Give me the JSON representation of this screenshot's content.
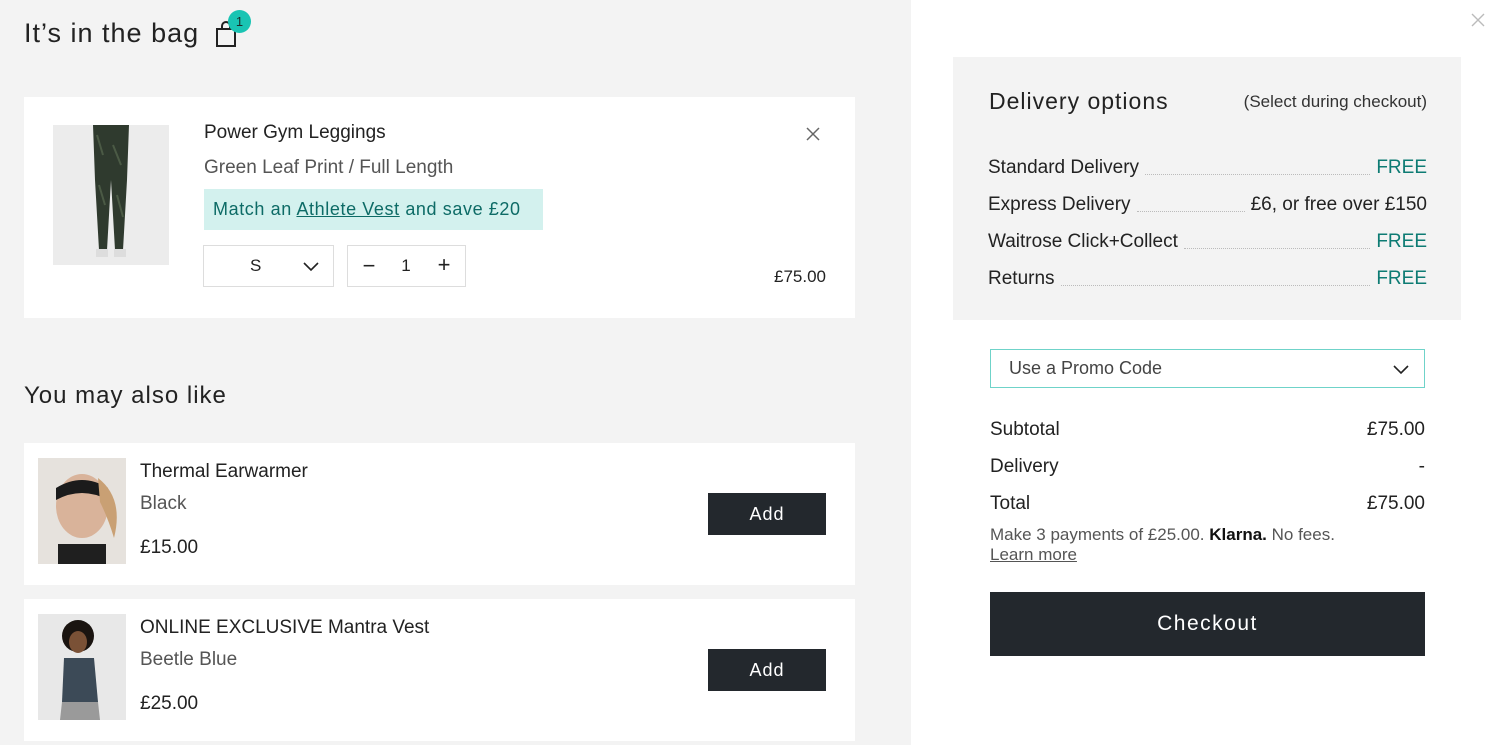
{
  "bag": {
    "title": "It’s in the bag",
    "count": "1",
    "item": {
      "name": "Power Gym Leggings",
      "variant": "Green Leaf Print / Full Length",
      "promo_prefix": "Match an ",
      "promo_link": "Athlete Vest",
      "promo_suffix": " and save £20",
      "size": "S",
      "quantity": "1",
      "price": "£75.00"
    }
  },
  "recommendations": {
    "title": "You may also like",
    "items": [
      {
        "name": "Thermal Earwarmer",
        "color": "Black",
        "price": "£15.00",
        "button": "Add"
      },
      {
        "name": "ONLINE EXCLUSIVE Mantra Vest",
        "color": "Beetle Blue",
        "price": "£25.00",
        "button": "Add"
      }
    ]
  },
  "delivery": {
    "title": "Delivery options",
    "note": "(Select during checkout)",
    "options": [
      {
        "label": "Standard Delivery",
        "value": "FREE"
      },
      {
        "label": "Express Delivery",
        "value": "£6, or free over £150"
      },
      {
        "label": "Waitrose Click+Collect",
        "value": "FREE"
      },
      {
        "label": "Returns",
        "value": "FREE"
      }
    ]
  },
  "promo": {
    "label": "Use a Promo Code"
  },
  "summary": {
    "subtotal_label": "Subtotal",
    "subtotal_value": "£75.00",
    "delivery_label": "Delivery",
    "delivery_value": "-",
    "total_label": "Total",
    "total_value": "£75.00",
    "klarna_prefix": "Make 3 payments of £25.00. ",
    "klarna_brand": "Klarna.",
    "klarna_suffix": " No fees.",
    "learn_more": "Learn more"
  },
  "checkout": {
    "label": "Checkout"
  },
  "colors": {
    "accent": "#19c4b3",
    "free_text": "#0d7b73",
    "button_dark": "#23282d",
    "promo_bg": "#d3f1ee"
  },
  "icons": {
    "bag": "shopping-bag-icon",
    "remove": "close-icon",
    "chevron": "chevron-down-icon",
    "close_panel": "close-icon"
  }
}
